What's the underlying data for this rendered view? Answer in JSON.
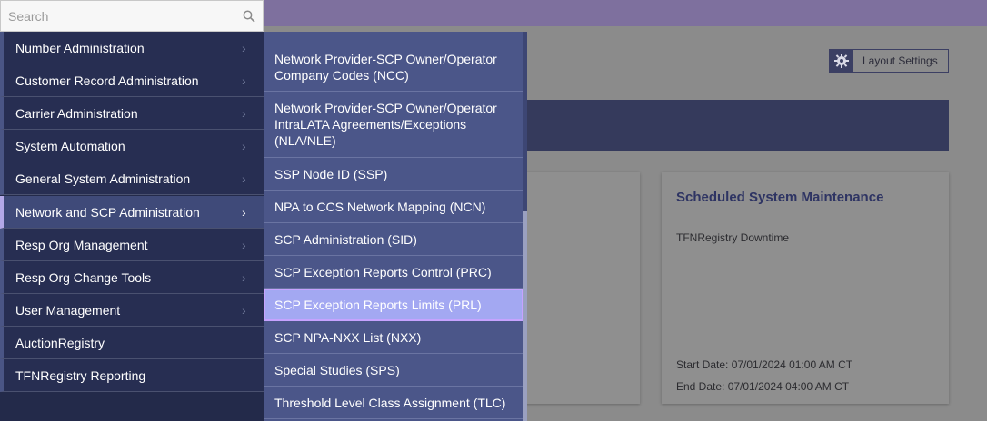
{
  "search": {
    "placeholder": "Search"
  },
  "menu": {
    "items": [
      {
        "label": "Number Administration",
        "has_submenu": true
      },
      {
        "label": "Customer Record Administration",
        "has_submenu": true
      },
      {
        "label": "Carrier Administration",
        "has_submenu": true
      },
      {
        "label": "System Automation",
        "has_submenu": true
      },
      {
        "label": "General System Administration",
        "has_submenu": true
      },
      {
        "label": "Network and SCP Administration",
        "has_submenu": true,
        "active": true
      },
      {
        "label": "Resp Org Management",
        "has_submenu": true
      },
      {
        "label": "Resp Org Change Tools",
        "has_submenu": true
      },
      {
        "label": "User Management",
        "has_submenu": true
      },
      {
        "label": "AuctionRegistry",
        "has_submenu": false
      },
      {
        "label": "TFNRegistry Reporting",
        "has_submenu": false
      }
    ],
    "chevron": "›"
  },
  "submenu": {
    "items": [
      {
        "label": "Network Provider-SCP Owner/Operator Company Codes (NCC)"
      },
      {
        "label": "Network Provider-SCP Owner/Operator IntraLATA Agreements/Exceptions (NLA/NLE)"
      },
      {
        "label": "SSP Node ID (SSP)"
      },
      {
        "label": "NPA to CCS Network Mapping (NCN)"
      },
      {
        "label": "SCP Administration (SID)"
      },
      {
        "label": "SCP Exception Reports Control (PRC)"
      },
      {
        "label": "SCP Exception Reports Limits (PRL)",
        "highlighted": true
      },
      {
        "label": "SCP NPA-NXX List (NXX)"
      },
      {
        "label": "Special Studies (SPS)"
      },
      {
        "label": "Threshold Level Class Assignment (TLC)"
      }
    ]
  },
  "toolbar": {
    "layout_settings_label": "Layout Settings",
    "layout_icon": "gear-icon"
  },
  "maintenance_card": {
    "title": "Scheduled System Maintenance",
    "subtitle": "TFNRegistry Downtime",
    "start_date": "Start Date: 07/01/2024 01:00 AM CT",
    "end_date": "End Date:  07/01/2024 04:00 AM CT"
  },
  "colors": {
    "menu_bg": "#272e52",
    "submenu_bg": "#4b5689",
    "highlight": "#a3a8f2",
    "topbar": "#7e709e"
  }
}
